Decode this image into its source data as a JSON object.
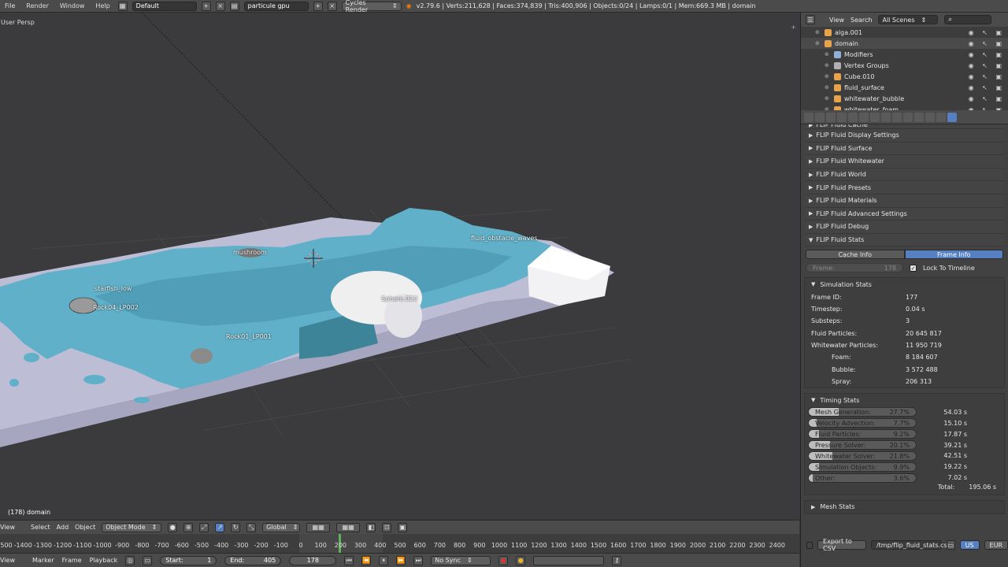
{
  "topbar": {
    "menus": [
      "File",
      "Render",
      "Window",
      "Help"
    ],
    "layout": "Default",
    "scene": "particule gpu",
    "engine": "Cycles Render",
    "stats": "v2.79.6 | Verts:211,628 | Faces:374,839 | Tris:400,906 | Objects:0/24 | Lamps:0/1 | Mem:669.3 MB | domain"
  },
  "viewport": {
    "view_name": "User Persp",
    "object_label": "(178) domain",
    "labels": {
      "starfish": "starfish_low",
      "rock04": "Rock04_LP002",
      "rock01": "Rock01_LP001",
      "obstacle": "fluid_obstacle_waves",
      "sphere": "Sphere.023",
      "mushroom": "mushroom"
    }
  },
  "view_header": {
    "menus": [
      "View",
      "Select",
      "Add",
      "Object"
    ],
    "mode": "Object Mode",
    "orientation": "Global"
  },
  "timeline": {
    "ticks": [
      -1500,
      -1400,
      -1300,
      -1200,
      -1100,
      -1000,
      -900,
      -800,
      -700,
      -600,
      -500,
      -400,
      -300,
      -200,
      -100,
      0,
      100,
      200,
      300,
      400,
      500,
      600,
      700,
      800,
      900,
      1000,
      1100,
      1200,
      1300,
      1400,
      1500,
      1600,
      1700,
      1800,
      1900,
      2000,
      2100,
      2200,
      2300,
      2400
    ],
    "menus": [
      "View",
      "Marker",
      "Frame",
      "Playback"
    ],
    "start_label": "Start:",
    "start": "1",
    "end_label": "End:",
    "end": "405",
    "current": "178",
    "sync": "No Sync"
  },
  "outliner": {
    "menus": [
      "View",
      "Search"
    ],
    "scenes": "All Scenes",
    "items": [
      "alga.001",
      "domain",
      "Modifiers",
      "Vertex Groups",
      "Cube.010",
      "fluid_surface",
      "whitewater_bubble",
      "whitewater_foam"
    ]
  },
  "panels": {
    "collapsed": [
      "FLIP Fluid Cache",
      "FLIP Fluid Display Settings",
      "FLIP Fluid Surface",
      "FLIP Fluid Whitewater",
      "FLIP Fluid World",
      "FLIP Fluid Presets",
      "FLIP Fluid Materials",
      "FLIP Fluid Advanced Settings",
      "FLIP Fluid Debug"
    ],
    "stats_title": "FLIP Fluid Stats",
    "tab_cache": "Cache Info",
    "tab_frame": "Frame Info",
    "frame_label": "Frame:",
    "frame_value": "178",
    "lock_label": "Lock To Timeline"
  },
  "sim_stats": {
    "title": "Simulation Stats",
    "rows": [
      {
        "k": "Frame ID:",
        "v": "177"
      },
      {
        "k": "Timestep:",
        "v": "0.04 s"
      },
      {
        "k": "Substeps:",
        "v": "3"
      },
      {
        "k": "Fluid Particles:",
        "v": "20 645 817"
      },
      {
        "k": "Whitewater Particles:",
        "v": "11 950 719"
      },
      {
        "k": "Foam:",
        "v": "8 184 607"
      },
      {
        "k": "Bubble:",
        "v": "3 572 488"
      },
      {
        "k": "Spray:",
        "v": "206 313"
      }
    ]
  },
  "timing_stats": {
    "title": "Timing Stats",
    "rows": [
      {
        "k": "Mesh Generation:",
        "p": "27.7%",
        "t": "54.03 s",
        "frac": 0.277
      },
      {
        "k": "Velocity Advection:",
        "p": "7.7%",
        "t": "15.10 s",
        "frac": 0.077
      },
      {
        "k": "Fluid Particles:",
        "p": "9.2%",
        "t": "17.87 s",
        "frac": 0.092
      },
      {
        "k": "Pressure Solver:",
        "p": "20.1%",
        "t": "39.21 s",
        "frac": 0.201
      },
      {
        "k": "Whitewater Solver:",
        "p": "21.8%",
        "t": "42.51 s",
        "frac": 0.218
      },
      {
        "k": "Simulation Objects:",
        "p": "9.9%",
        "t": "19.22 s",
        "frac": 0.099
      },
      {
        "k": "Other:",
        "p": "3.6%",
        "t": "7.02 s",
        "frac": 0.036
      }
    ],
    "total_label": "Total:",
    "total": "195.06 s"
  },
  "mesh_stats": {
    "title": "Mesh Stats"
  },
  "footer": {
    "export": "Export to CSV",
    "path": "/tmp/flip_fluid_stats.csv",
    "us": "US",
    "eur": "EUR"
  },
  "colors": {
    "accent": "#5680c2",
    "water": "#5fb0c8",
    "frame": "#5db35a"
  }
}
